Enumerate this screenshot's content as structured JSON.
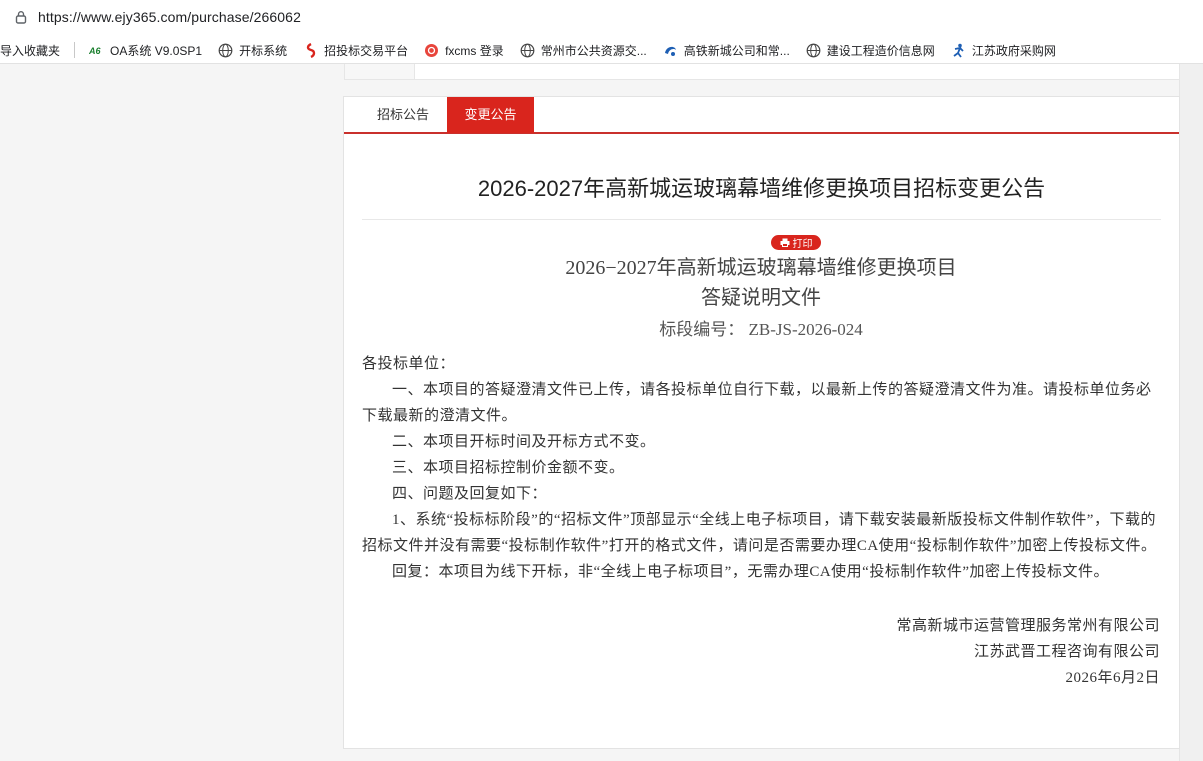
{
  "browser": {
    "url": "https://www.ejy365.com/purchase/266062",
    "bookmarks": [
      {
        "label": "导入收藏夹",
        "icon": "import-icon"
      },
      {
        "label": "OA系统 V9.0SP1",
        "icon": "oa-logo-icon"
      },
      {
        "label": "开标系统",
        "icon": "globe-icon"
      },
      {
        "label": "招投标交易平台",
        "icon": "bid-logo-icon"
      },
      {
        "label": "fxcms 登录",
        "icon": "fxcms-logo-icon"
      },
      {
        "label": "常州市公共资源交...",
        "icon": "globe-icon"
      },
      {
        "label": "高铁新城公司和常...",
        "icon": "swirl-logo-icon"
      },
      {
        "label": "建设工程造价信息网",
        "icon": "globe-icon"
      },
      {
        "label": "江苏政府采购网",
        "icon": "runner-logo-icon"
      }
    ]
  },
  "tabs": [
    {
      "label": "招标公告",
      "active": false
    },
    {
      "label": "变更公告",
      "active": true
    }
  ],
  "page_title": "2026-2027年高新城运玻璃幕墙维修更换项目招标变更公告",
  "print_label": "打印",
  "document": {
    "title_line1": "2026−2027年高新城运玻璃幕墙维修更换项目",
    "title_line2": "答疑说明文件",
    "section_no": "标段编号： ZB-JS-2026-024",
    "salutation": "各投标单位：",
    "p1": "一、本项目的答疑澄清文件已上传，请各投标单位自行下载，以最新上传的答疑澄清文件为准。请投标单位务必下载最新的澄清文件。",
    "p2": "二、本项目开标时间及开标方式不变。",
    "p3": "三、本项目招标控制价金额不变。",
    "p4": "四、问题及回复如下：",
    "p5": "1、系统“投标标阶段”的“招标文件”顶部显示“全线上电子标项目，请下载安装最新版投标文件制作软件”，下载的招标文件并没有需要“投标制作软件”打开的格式文件，请问是否需要办理CA使用“投标制作软件”加密上传投标文件。",
    "p6": "回复：本项目为线下开标，非“全线上电子标项目”，无需办理CA使用“投标制作软件”加密上传投标文件。",
    "sign1": "常高新城市运营管理服务常州有限公司",
    "sign2": "江苏武晋工程咨询有限公司",
    "date": "2026年6月2日"
  },
  "colors": {
    "accent": "#d9251d"
  }
}
